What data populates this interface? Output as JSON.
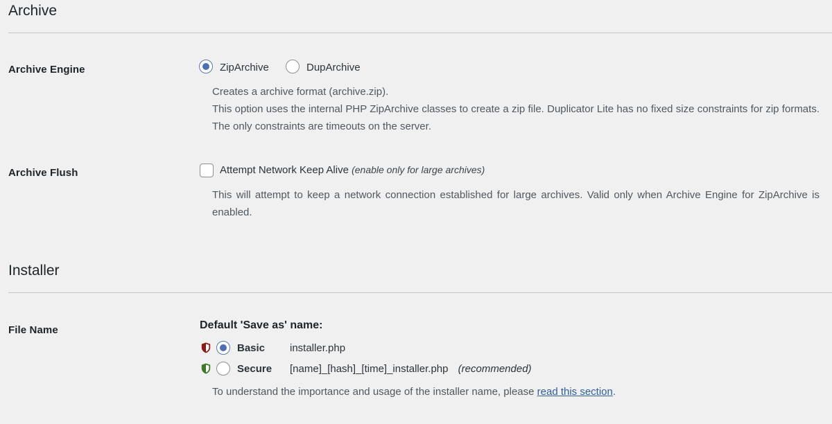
{
  "archive": {
    "title": "Archive",
    "engine": {
      "label": "Archive Engine",
      "options": [
        {
          "label": "ZipArchive",
          "checked": true
        },
        {
          "label": "DupArchive",
          "checked": false
        }
      ],
      "desc_line1": "Creates a archive format (archive.zip).",
      "desc_italic": "This option uses the internal PHP ZipArchive classes to create a zip file.  Duplicator Lite has no fixed size constraints for zip formats. The only constraints are timeouts on the server."
    },
    "flush": {
      "label": "Archive Flush",
      "checkbox_label": "Attempt Network Keep Alive",
      "checkbox_note": "(enable only for large archives)",
      "desc": "This will attempt to keep a network connection established for large archives.  Valid only when Archive Engine for ZipArchive is enabled."
    }
  },
  "installer": {
    "title": "Installer",
    "file_name": {
      "label": "File Name",
      "heading": "Default 'Save as' name:",
      "options": [
        {
          "label": "Basic",
          "value": "installer.php",
          "note": "",
          "checked": true,
          "shield_color": "#8a1c1c"
        },
        {
          "label": "Secure",
          "value": "[name]_[hash]_[time]_installer.php",
          "note": "(recommended)",
          "checked": false,
          "shield_color": "#3c7a2a"
        }
      ],
      "help_text": "To understand the importance and usage of the installer name, please",
      "help_link": "read this section",
      "help_end": "."
    }
  }
}
